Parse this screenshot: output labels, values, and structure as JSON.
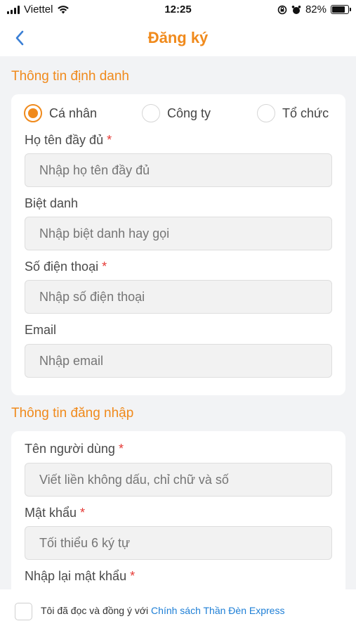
{
  "status_bar": {
    "carrier": "Viettel",
    "time": "12:25",
    "battery": "82%",
    "battery_level": 0.82
  },
  "nav": {
    "title": "Đăng ký",
    "back_icon": "chevron-left-icon"
  },
  "identity": {
    "title": "Thông tin định danh",
    "options": [
      {
        "label": "Cá nhân",
        "checked": true
      },
      {
        "label": "Công ty",
        "checked": false
      },
      {
        "label": "Tổ chức",
        "checked": false
      }
    ],
    "fullname": {
      "label": "Họ tên đầy đủ",
      "required": "*",
      "placeholder": "Nhập họ tên đầy đủ"
    },
    "nickname": {
      "label": "Biệt danh",
      "placeholder": "Nhập biệt danh hay gọi"
    },
    "phone": {
      "label": "Số điện thoại",
      "required": "*",
      "placeholder": "Nhập số điện thoại"
    },
    "email": {
      "label": "Email",
      "placeholder": "Nhập email"
    }
  },
  "login": {
    "title": "Thông tin đăng nhập",
    "username": {
      "label": "Tên người dùng",
      "required": "*",
      "placeholder": "Viết liền không dấu, chỉ chữ và số"
    },
    "password": {
      "label": "Mật khẩu",
      "required": "*",
      "placeholder": "Tối thiểu 6 ký tự"
    },
    "confirm": {
      "label": "Nhập lại mật khẩu",
      "required": "*"
    }
  },
  "agreement": {
    "text": "Tôi đã đọc và đồng ý với ",
    "link": "Chính sách Thần Đèn Express"
  },
  "colors": {
    "accent": "#f08a1c",
    "required": "#e53935",
    "link": "#1e7fd6"
  }
}
